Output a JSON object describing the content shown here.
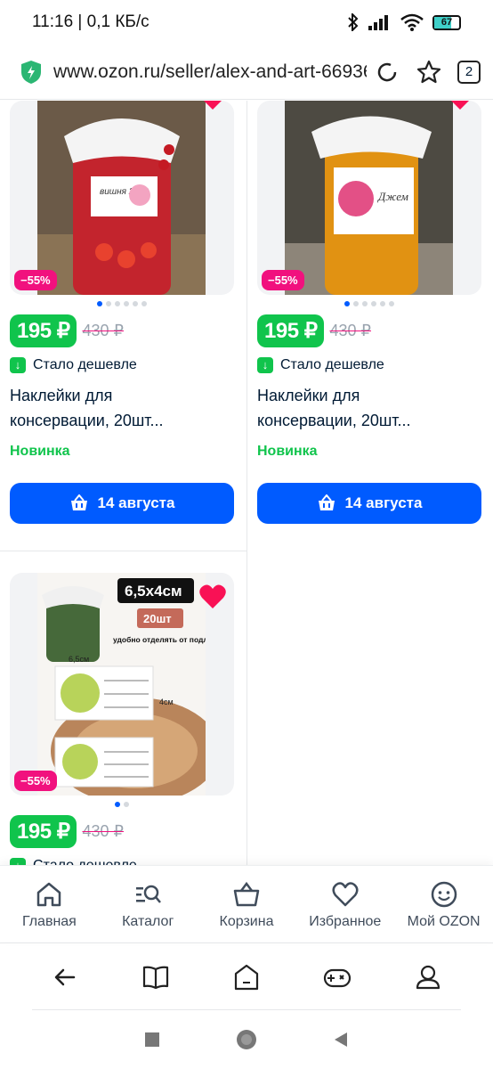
{
  "status_bar": {
    "time_speed": "11:16 | 0,1 КБ/с",
    "battery": "67"
  },
  "browser": {
    "url": "www.ozon.ru/seller/alex-and-art-66936",
    "tabs_count": "2"
  },
  "products": [
    {
      "discount": "−55%",
      "price": "195 ₽",
      "old_price": "430 ₽",
      "cheaper": "Стало дешевле",
      "title_line1": "Наклейки для",
      "title_line2": "консервации, 20шт...",
      "badge": "Новинка",
      "buy_label": "14 августа",
      "dots": 6,
      "active_dot": 0,
      "jar_label": "вишня 2023"
    },
    {
      "discount": "−55%",
      "price": "195 ₽",
      "old_price": "430 ₽",
      "cheaper": "Стало дешевле",
      "title_line1": "Наклейки для",
      "title_line2": "консервации, 20шт...",
      "badge": "Новинка",
      "buy_label": "14 августа",
      "dots": 6,
      "active_dot": 0,
      "jar_label": "Джем"
    },
    {
      "discount": "−55%",
      "price": "195 ₽",
      "old_price": "430 ₽",
      "cheaper": "Стало дешевле",
      "dots": 2,
      "active_dot": 0,
      "size_tag": "6,5х4см",
      "count_tag": "20шт",
      "note": "удобно отделять от подложки",
      "dim_w": "6,5см",
      "dim_h": "4см"
    }
  ],
  "bottom_nav": [
    {
      "label": "Главная",
      "icon": "home-icon"
    },
    {
      "label": "Каталог",
      "icon": "catalog-search-icon"
    },
    {
      "label": "Корзина",
      "icon": "cart-icon"
    },
    {
      "label": "Избранное",
      "icon": "heart-icon"
    },
    {
      "label": "Мой OZON",
      "icon": "profile-smile-icon"
    }
  ],
  "colors": {
    "accent": "#005bff",
    "price_green": "#10c44c",
    "discount_pink": "#f1117e",
    "heart_red": "#f91155"
  }
}
